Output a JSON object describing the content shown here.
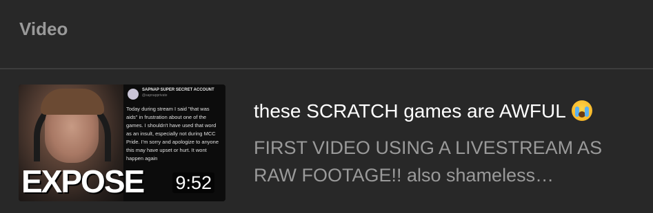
{
  "section": {
    "title": "Video"
  },
  "video": {
    "title": "these SCRATCH games are AWFUL",
    "title_emoji": "loudly-crying-face-emoji",
    "description_line1": "FIRST VIDEO USING A LIVESTREAM AS",
    "description_line2": "RAW FOOTAGE!! also shameless…",
    "duration": "9:52",
    "thumbnail": {
      "overlay_text": "EXPOSE",
      "tweet_name": "SAPNAP SUPER SECRET ACCOUNT",
      "tweet_handle": "@sapnapprivate",
      "tweet_text": "Today during stream I said \"that was aids\" in frustration about one of the games. I shouldn't have used that word as an insult, especially not during MCC Pride. I'm sorry and apologize to anyone this may have upset or hurt. It wont happen again"
    }
  },
  "colors": {
    "background": "#282828",
    "header_text": "#9a9a9a",
    "title_text": "#ffffff",
    "description_text": "#9a9a9a",
    "divider": "#3d3d3d"
  }
}
